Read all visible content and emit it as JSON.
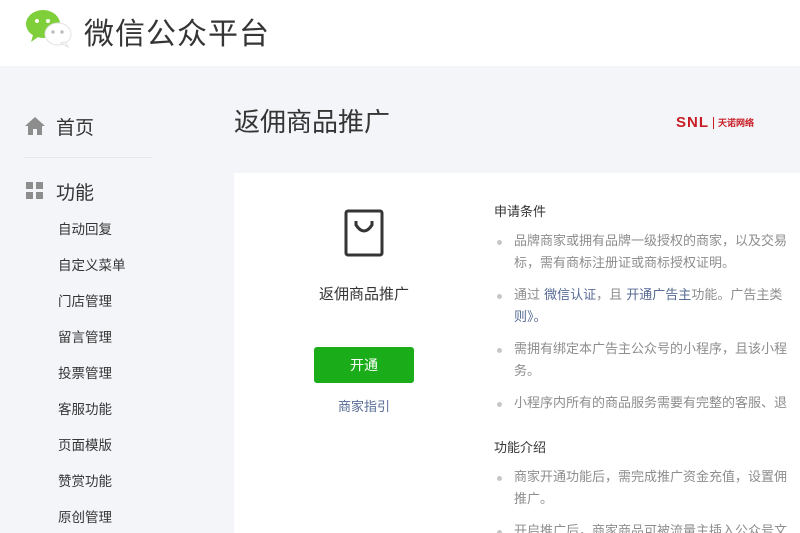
{
  "header": {
    "brand_title": "微信公众平台",
    "logo_icon": "wechat-logo-icon"
  },
  "sidebar": {
    "home_label": "首页",
    "func_label": "功能",
    "sub_items": [
      "自动回复",
      "自定义菜单",
      "门店管理",
      "留言管理",
      "投票管理",
      "客服功能",
      "页面模版",
      "赞赏功能",
      "原创管理"
    ]
  },
  "main": {
    "title": "返佣商品推广",
    "partner": {
      "name": "SNL",
      "sub": "天诺网络"
    }
  },
  "card": {
    "name": "返佣商品推广",
    "open_label": "开通",
    "guide_label": "商家指引",
    "conditions_title": "申请条件",
    "cond1_l1": "品牌商家或拥有品牌一级授权的商家，以及交易",
    "cond1_l2": "标，需有商标注册证或商标授权证明。",
    "cond2_pre": "通过 ",
    "cond2_link1": "微信认证",
    "cond2_mid": "，且 ",
    "cond2_link2": "开通广告主",
    "cond2_post": "功能。广告主类",
    "cond2_l2": "则》。",
    "cond3_l1": "需拥有绑定本广告主公众号的小程序，且该小程",
    "cond3_l2": "务。",
    "cond4_l1": "小程序内所有的商品服务需要有完整的客服、退",
    "intro_title": "功能介绍",
    "intro1_l1": "商家开通功能后，需完成推广资金充值，设置佣",
    "intro1_l2": "推广。",
    "intro2_l1": "开启推广后，商家商品可被流量主插入公众号文"
  },
  "colors": {
    "accent_green": "#1aad19",
    "link_blue": "#576b95",
    "partner_red": "#c81d25"
  }
}
